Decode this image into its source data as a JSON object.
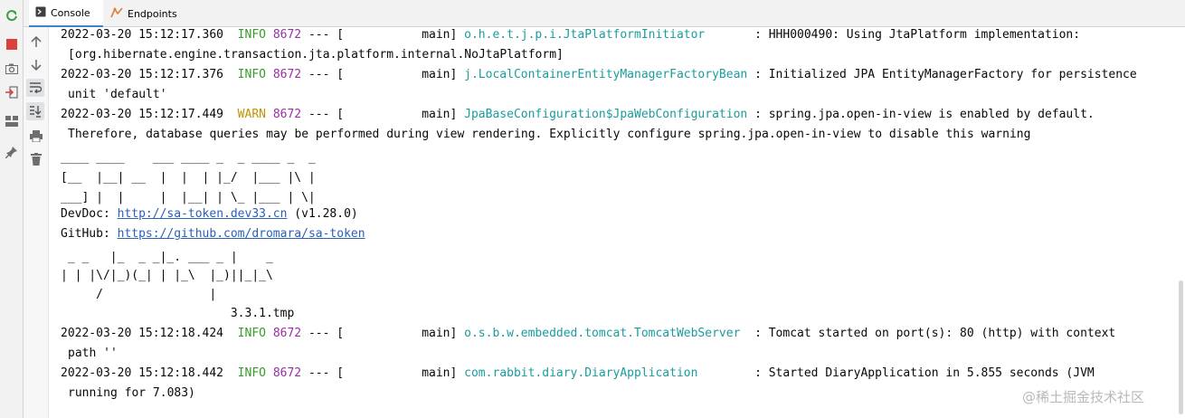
{
  "tabs": [
    {
      "label": "Console",
      "icon": "console-icon",
      "active": true
    },
    {
      "label": "Endpoints",
      "icon": "endpoints-icon",
      "active": false
    }
  ],
  "colors": {
    "info": "#389b2b",
    "warn": "#c09300",
    "pid": "#9b2ea4",
    "logger": "#1a9c9c",
    "link": "#2a60b8",
    "rerun_icon": "#3e9d4b",
    "stop_icon": "#d9413c"
  },
  "toolbar_left_icons": [
    "rerun-icon",
    "stop-icon",
    "camera-icon",
    "exit-icon",
    "layout-icon",
    "pin-icon"
  ],
  "toolbar_console_icons": [
    "up-arrow-icon",
    "down-arrow-icon",
    "soft-wrap-icon",
    "scroll-to-end-icon",
    "print-icon",
    "trash-icon"
  ],
  "log": {
    "l1": {
      "ts": "2022-03-20 15:12:17.360",
      "level": "INFO",
      "pid": "8672",
      "sep": "--- [",
      "thread": "main]",
      "logger": "o.h.e.t.j.p.i.JtaPlatformInitiator",
      "msg": ": HHH000490: Using JtaPlatform implementation:",
      "cont": "[org.hibernate.engine.transaction.jta.platform.internal.NoJtaPlatform]"
    },
    "l2": {
      "ts": "2022-03-20 15:12:17.376",
      "level": "INFO",
      "pid": "8672",
      "sep": "--- [",
      "thread": "main]",
      "logger": "j.LocalContainerEntityManagerFactoryBean",
      "msg": ": Initialized JPA EntityManagerFactory for persistence",
      "cont": "unit 'default'"
    },
    "l3": {
      "ts": "2022-03-20 15:12:17.449",
      "level": "WARN",
      "pid": "8672",
      "sep": "--- [",
      "thread": "main]",
      "logger": "JpaBaseConfiguration$JpaWebConfiguration",
      "msg": ": spring.jpa.open-in-view is enabled by default.",
      "cont": "Therefore, database queries may be performed during view rendering. Explicitly configure spring.jpa.open-in-view to disable this warning"
    },
    "l4": {
      "ts": "2022-03-20 15:12:18.424",
      "level": "INFO",
      "pid": "8672",
      "sep": "--- [",
      "thread": "main]",
      "logger": "o.s.b.w.embedded.tomcat.TomcatWebServer",
      "msg": ": Tomcat started on port(s): 80 (http) with context",
      "cont": "path ''"
    },
    "l5": {
      "ts": "2022-03-20 15:12:18.442",
      "level": "INFO",
      "pid": "8672",
      "sep": "--- [",
      "thread": "main]",
      "logger": "com.rabbit.diary.DiaryApplication",
      "msg": ": Started DiaryApplication in 5.855 seconds (JVM",
      "cont": "running for 7.083)"
    }
  },
  "banner_satoken": [
    "____ ____    ___ ____ _  _ ____ _  _",
    "[__  |__| __  |  |  | |_/  |___ |\\ |",
    "___] |  |     |  |__| | \\_ |___ | \\|"
  ],
  "devdoc": {
    "label": "DevDoc:",
    "url": "http://sa-token.dev33.cn",
    "version": " (v1.28.0)"
  },
  "github": {
    "label": "GitHub:",
    "url": "https://github.com/dromara/sa-token"
  },
  "banner_mp": [
    " _ _   |_  _ _|_. ___ _ |    _",
    "| | |\\/|_)(_| | |_\\  |_)||_|_\\",
    "     /               |",
    "                        3.3.1.tmp"
  ],
  "watermark": "@稀土掘金技术社区"
}
